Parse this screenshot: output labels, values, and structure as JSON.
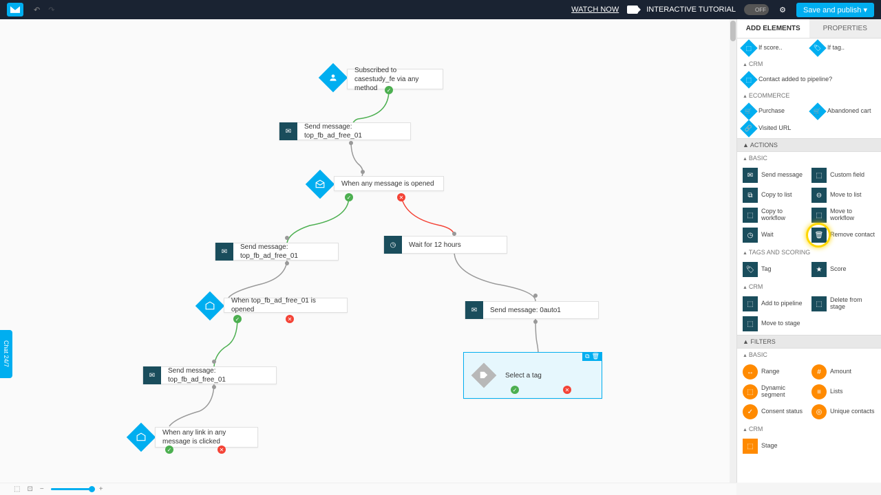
{
  "topbar": {
    "watch_now": "WATCH NOW",
    "tutorial": "INTERACTIVE TUTORIAL",
    "toggle": "OFF",
    "save": "Save and publish ▾"
  },
  "nodes": {
    "n1": "Subscribed to casestudy_fe via any method",
    "n2": "Send message: top_fb_ad_free_01",
    "n3": "When any message is opened",
    "n4": "Send message: top_fb_ad_free_01",
    "n5": "Wait for 12 hours",
    "n6": "When top_fb_ad_free_01 is opened",
    "n7": "Send message: 0auto1",
    "n8": "Send message: top_fb_ad_free_01",
    "n9": "Select a tag",
    "n10": "When any link in any message is clicked"
  },
  "panel": {
    "tab_add": "ADD ELEMENTS",
    "tab_props": "PROPERTIES",
    "cond": {
      "if_score": "If score..",
      "if_tag": "If tag..",
      "crm": "CRM",
      "contact_pipeline": "Contact added to pipeline?",
      "ecom": "ECOMMERCE",
      "purchase": "Purchase",
      "abandoned": "Abandoned cart",
      "visited": "Visited URL"
    },
    "actions_hdr": "ACTIONS",
    "basic_hdr": "BASIC",
    "act": {
      "send": "Send message",
      "custom": "Custom field",
      "copy_list": "Copy to list",
      "move_list": "Move to list",
      "copy_wf": "Copy to workflow",
      "move_wf": "Move to workflow",
      "wait": "Wait",
      "remove": "Remove contact"
    },
    "tags_hdr": "TAGS AND SCORING",
    "tags": {
      "tag": "Tag",
      "score": "Score"
    },
    "crm_hdr": "CRM",
    "crm": {
      "add_pipe": "Add to pipeline",
      "del_stage": "Delete from stage",
      "move_stage": "Move to stage"
    },
    "filters_hdr": "FILTERS",
    "filt": {
      "range": "Range",
      "amount": "Amount",
      "dynseg": "Dynamic segment",
      "lists": "Lists",
      "consent": "Consent status",
      "unique": "Unique contacts"
    },
    "crm2_hdr": "CRM",
    "crm2": {
      "stage": "Stage"
    }
  },
  "chat": "Chat 24/7"
}
